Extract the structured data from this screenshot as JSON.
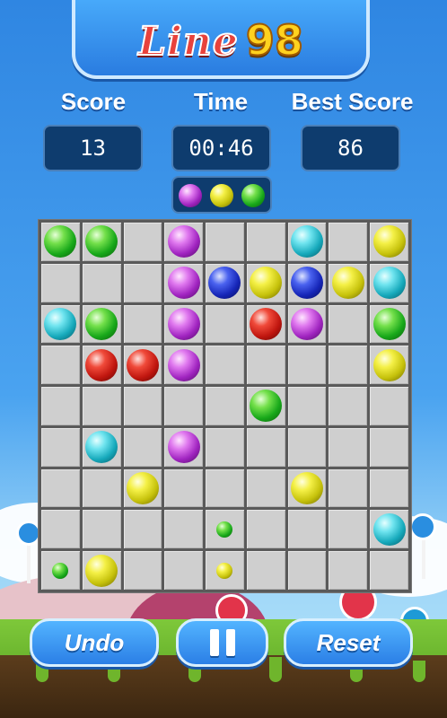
{
  "title": {
    "word": "Line",
    "number": "98"
  },
  "stats": {
    "score_label": "Score",
    "score_value": "13",
    "time_label": "Time",
    "time_value": "00:46",
    "best_label": "Best Score",
    "best_value": "86"
  },
  "next_balls": [
    "purple",
    "yellow",
    "green"
  ],
  "board": {
    "size": 9,
    "cells": [
      [
        "green",
        "green",
        "",
        "purple",
        "",
        "",
        "cyan",
        "",
        "yellow"
      ],
      [
        "",
        "",
        "",
        "purple",
        "blue",
        "yellow",
        "blue",
        "yellow",
        "cyan"
      ],
      [
        "cyan",
        "green",
        "",
        "purple",
        "",
        "red",
        "purple",
        "",
        "green"
      ],
      [
        "",
        "red",
        "red",
        "purple",
        "",
        "",
        "",
        "",
        "yellow"
      ],
      [
        "",
        "",
        "",
        "",
        "",
        "green",
        "",
        "",
        ""
      ],
      [
        "",
        "cyan",
        "",
        "purple",
        "",
        "",
        "",
        "",
        ""
      ],
      [
        "",
        "",
        "yellow",
        "",
        "",
        "",
        "yellow",
        "",
        ""
      ],
      [
        "",
        "",
        "",
        "",
        "green:small",
        "",
        "",
        "",
        "cyan"
      ],
      [
        "green:small",
        "yellow",
        "",
        "",
        "yellow:small",
        "",
        "",
        "",
        ""
      ]
    ]
  },
  "buttons": {
    "undo": "Undo",
    "pause": "pause",
    "reset": "Reset"
  },
  "colors": {
    "green": "#18a81a",
    "purple": "#a024c0",
    "cyan": "#16a9bb",
    "yellow": "#c6c20c",
    "blue": "#1626b8",
    "red": "#c0160f"
  }
}
